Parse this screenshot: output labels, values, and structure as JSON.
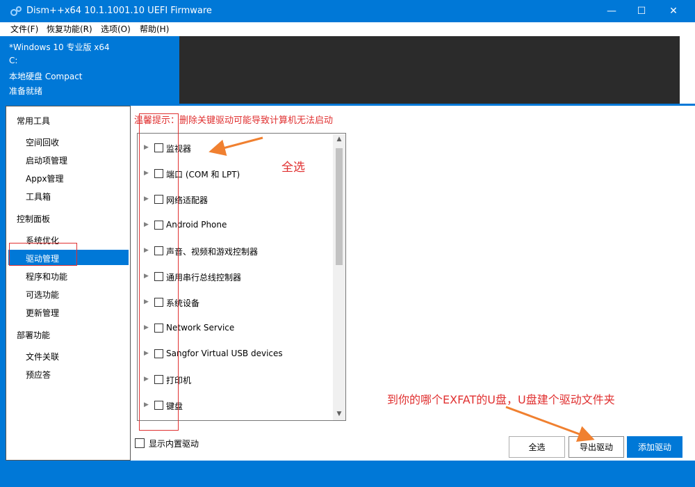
{
  "window": {
    "title": "Dism++x64 10.1.1001.10 UEFI Firmware",
    "minimize": "—",
    "maximize": "☐",
    "close": "✕"
  },
  "menu": {
    "file": "文件(F)",
    "recovery": "恢复功能(R)",
    "options": "选项(O)",
    "help": "帮助(H)"
  },
  "image_info": {
    "name": "*Windows 10 专业版 x64",
    "drive": "C:",
    "disk": "本地硬盘 Compact",
    "status": "准备就绪"
  },
  "nav": {
    "tools_header": "常用工具",
    "space_cleanup": "空间回收",
    "startup": "启动项管理",
    "appx": "Appx管理",
    "toolbox": "工具箱",
    "control_header": "控制面板",
    "sys_opt": "系统优化",
    "drivers": "驱动管理",
    "programs": "程序和功能",
    "optional": "可选功能",
    "updates": "更新管理",
    "deploy_header": "部署功能",
    "file_assoc": "文件关联",
    "preset": "预应答"
  },
  "main": {
    "warning": "温馨提示：删除关键驱动可能导致计算机无法启动",
    "drivers": [
      "监视器",
      "端口 (COM 和 LPT)",
      "网络适配器",
      "Android Phone",
      "声音、视频和游戏控制器",
      "通用串行总线控制器",
      "系统设备",
      "Network Service",
      "Sangfor Virtual USB devices",
      "打印机",
      "键盘"
    ],
    "show_builtin": "显示内置驱动",
    "btn_select_all": "全选",
    "btn_export": "导出驱动",
    "btn_add": "添加驱动"
  },
  "annotations": {
    "select_all": "全选",
    "usb_hint": "到你的哪个EXFAT的U盘，U盘建个驱动文件夹"
  },
  "colors": {
    "accent": "#0078d7",
    "annotation": "#e03030",
    "dark_panel": "#2b2b2b"
  }
}
